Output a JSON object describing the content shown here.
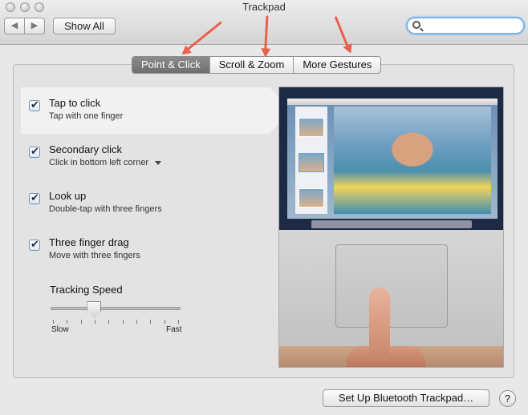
{
  "window": {
    "title": "Trackpad"
  },
  "toolbar": {
    "back_icon": "chevron-left-icon",
    "forward_icon": "chevron-right-icon",
    "back_glyph": "◀",
    "forward_glyph": "▶",
    "show_all_label": "Show All",
    "search_placeholder": ""
  },
  "tabs": [
    {
      "label": "Point & Click",
      "active": true
    },
    {
      "label": "Scroll & Zoom",
      "active": false
    },
    {
      "label": "More Gestures",
      "active": false
    }
  ],
  "options": [
    {
      "title": "Tap to click",
      "subtitle": "Tap with one finger",
      "checked": true,
      "selected": true
    },
    {
      "title": "Secondary click",
      "subtitle": "Click in bottom left corner",
      "checked": true,
      "selected": false,
      "has_dropdown": true
    },
    {
      "title": "Look up",
      "subtitle": "Double-tap with three fingers",
      "checked": true,
      "selected": false
    },
    {
      "title": "Three finger drag",
      "subtitle": "Move with three fingers",
      "checked": true,
      "selected": false
    }
  ],
  "tracking_speed": {
    "label": "Tracking Speed",
    "min_label": "Slow",
    "max_label": "Fast",
    "value_fraction": 0.33,
    "tick_count": 10
  },
  "footer": {
    "bluetooth_button_label": "Set Up Bluetooth Trackpad…",
    "help_label": "?"
  },
  "colors": {
    "annotation_arrow": "#e9604c",
    "active_tab": "#7a7a7a",
    "search_focus": "#7ab2ec"
  }
}
